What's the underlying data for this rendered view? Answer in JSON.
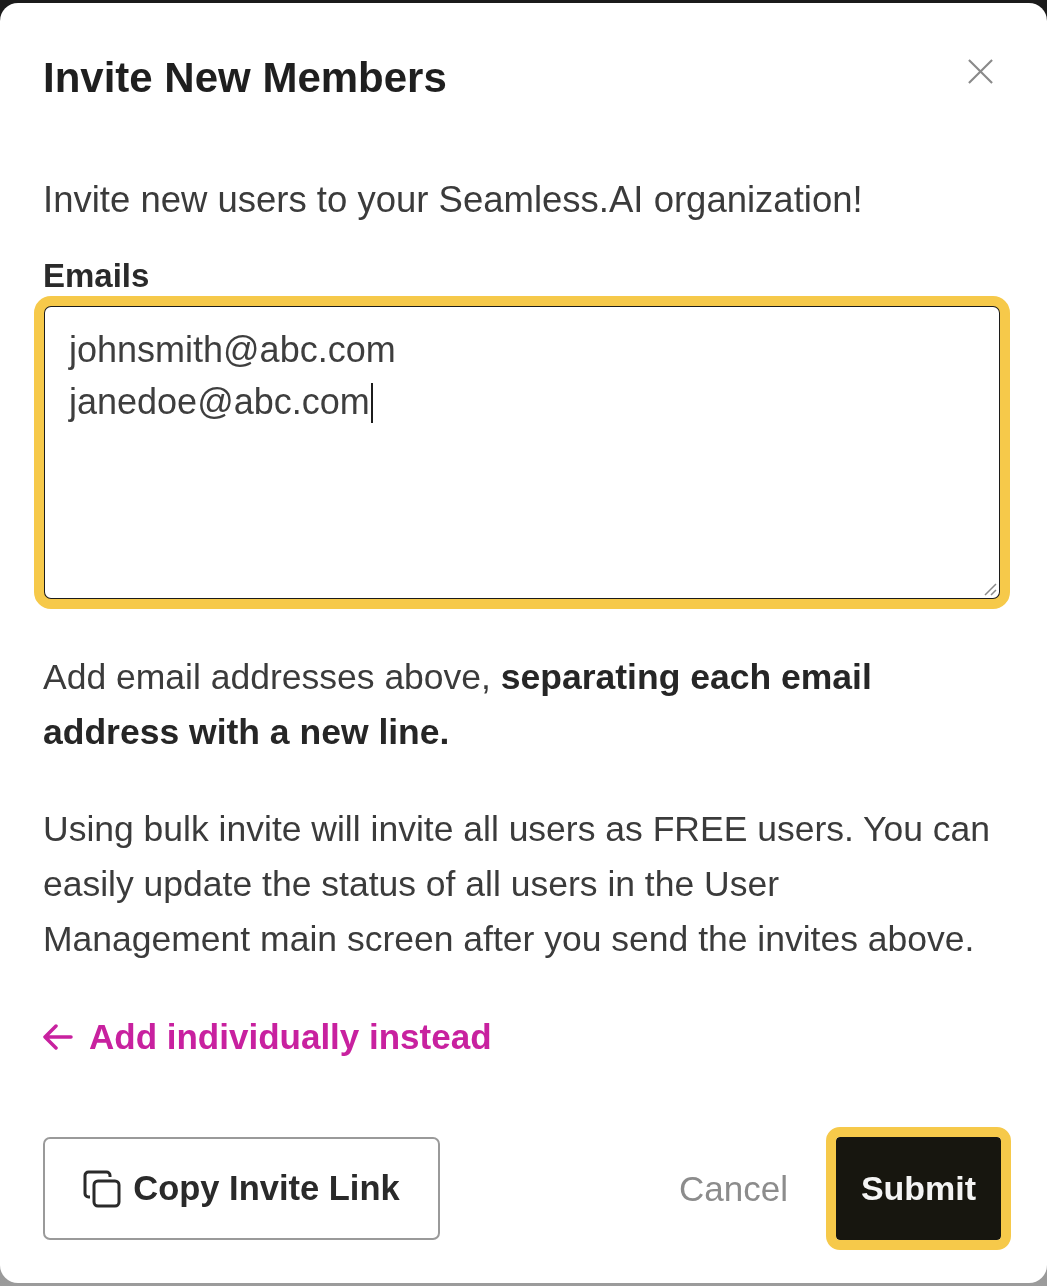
{
  "dialog": {
    "title": "Invite New Members"
  },
  "intro": "Invite new users to your Seamless.AI organization!",
  "emails": {
    "label": "Emails",
    "value": "johnsmith@abc.com\njanedoe@abc.com",
    "focused": true,
    "highlighted": true
  },
  "help": [
    "Add email addresses above, **separating each email address with a new line.**",
    "Using bulk invite will invite all users as FREE users. You can easily update the status of all users in the User Management main screen after you send the invites above."
  ],
  "link": {
    "label": "Add individually instead"
  },
  "buttons": [
    {
      "kind": "secondary",
      "label": "Copy Invite Link",
      "highlighted": false
    },
    {
      "kind": "text",
      "label": "Cancel",
      "highlighted": false
    },
    {
      "kind": "primary",
      "label": "Submit",
      "highlighted": true
    }
  ]
}
